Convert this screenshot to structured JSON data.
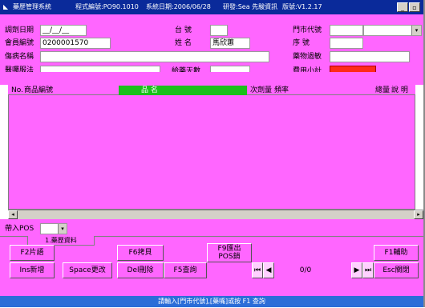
{
  "titlebar": {
    "app_name": "藥歷管理系統",
    "program_no": "程式編號:PO90.1010",
    "system_date": "系統日期:2006/06/28",
    "company": "研發:Sea 先駿資訊",
    "version": "版號:V1.2.17",
    "minimize": "_",
    "restore": "▫"
  },
  "form": {
    "date_label": "調劑日期",
    "date_value": "__/__/__",
    "counter_label": "台      號",
    "store_label": "門市代號",
    "member_label": "會員編號",
    "member_value": "0200001570",
    "name_label": "姓      名",
    "name_value": "馬欣蕙",
    "seq_label": "序      號",
    "disease_label": "傷病名稱",
    "allergy_label": "藥物過敏",
    "doctor_label": "醫囑服法",
    "days_label": "給藥天數",
    "subtotal_label": "費用小計",
    "subtotal_color": "#ff2a1a"
  },
  "grid": {
    "columns": [
      "No.",
      "商品編號",
      "品      名",
      "次劑量",
      "頻率",
      "總量",
      "說      明"
    ],
    "header_highlight": "#1bbf1b"
  },
  "pos": {
    "label": "帶入POS",
    "tab_label": "1.藥歷資料"
  },
  "buttons": {
    "f2": "F2片語",
    "f6": "F6拷貝",
    "f9": "F9匯出\nPOS銷",
    "f1": "F1輔助",
    "ins": "Ins新增",
    "space": "Space更改",
    "del": "Del刪除",
    "f5": "F5查詢",
    "esc": "Esc關閉"
  },
  "nav": {
    "page_value": "0/0"
  },
  "statusbar": {
    "message": "請輸入[門市代號],[藥嘴]或按 F1 查詢"
  }
}
